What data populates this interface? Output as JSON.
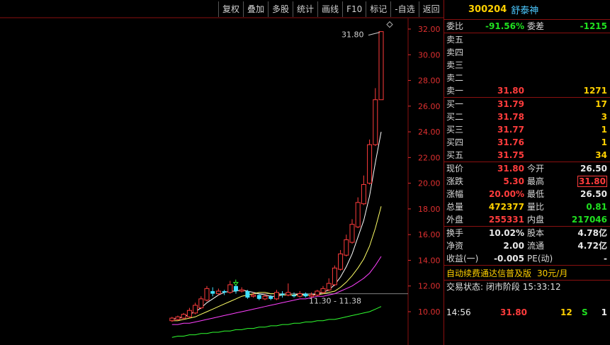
{
  "toolbar": {
    "buttons": [
      "复权",
      "叠加",
      "多股",
      "统计",
      "画线",
      "F10",
      "标记",
      "-自选",
      "返回"
    ]
  },
  "chart_data": {
    "type": "candlestick",
    "y_ticks": [
      "32.00",
      "30.00",
      "28.00",
      "26.00",
      "24.00",
      "22.00",
      "20.00",
      "18.00",
      "16.00",
      "14.00",
      "12.00",
      "10.00"
    ],
    "ylim": [
      9.6,
      32.4
    ],
    "annotations": {
      "max_label": "31.80",
      "range_label": "11.30 - 11.38"
    },
    "candles": [
      {
        "o": 9.3,
        "c": 9.5,
        "h": 9.6,
        "l": 9.2
      },
      {
        "o": 9.4,
        "c": 9.6,
        "h": 9.7,
        "l": 9.3
      },
      {
        "o": 9.5,
        "c": 9.8,
        "h": 9.9,
        "l": 9.4
      },
      {
        "o": 9.6,
        "c": 10.1,
        "h": 10.3,
        "l": 9.5
      },
      {
        "o": 9.9,
        "c": 10.5,
        "h": 10.7,
        "l": 9.8
      },
      {
        "o": 10.3,
        "c": 11.0,
        "h": 11.2,
        "l": 10.2
      },
      {
        "o": 10.9,
        "c": 11.8,
        "h": 12.0,
        "l": 10.8
      },
      {
        "o": 11.6,
        "c": 11.4,
        "h": 11.9,
        "l": 11.2
      },
      {
        "o": 11.4,
        "c": 11.6,
        "h": 11.8,
        "l": 11.3
      },
      {
        "o": 11.6,
        "c": 11.5,
        "h": 11.7,
        "l": 11.3
      },
      {
        "o": 11.5,
        "c": 12.1,
        "h": 12.4,
        "l": 11.4
      },
      {
        "o": 12.0,
        "c": 11.6,
        "h": 12.1,
        "l": 11.4
      },
      {
        "o": 11.6,
        "c": 11.7,
        "h": 11.9,
        "l": 11.5
      },
      {
        "o": 11.6,
        "c": 11.1,
        "h": 11.7,
        "l": 11.0
      },
      {
        "o": 11.2,
        "c": 11.3,
        "h": 11.5,
        "l": 11.1
      },
      {
        "o": 11.3,
        "c": 11.0,
        "h": 11.4,
        "l": 10.9
      },
      {
        "o": 11.0,
        "c": 11.2,
        "h": 11.4,
        "l": 10.9
      },
      {
        "o": 11.2,
        "c": 11.0,
        "h": 11.3,
        "l": 10.9
      },
      {
        "o": 11.0,
        "c": 11.5,
        "h": 11.7,
        "l": 10.9
      },
      {
        "o": 11.4,
        "c": 11.3,
        "h": 11.6,
        "l": 11.1
      },
      {
        "o": 11.3,
        "c": 11.5,
        "h": 12.2,
        "l": 11.2
      },
      {
        "o": 11.3,
        "c": 11.2,
        "h": 11.5,
        "l": 11.1
      },
      {
        "o": 11.2,
        "c": 11.4,
        "h": 11.6,
        "l": 11.1
      },
      {
        "o": 11.4,
        "c": 11.2,
        "h": 11.5,
        "l": 11.1
      },
      {
        "o": 11.2,
        "c": 11.3,
        "h": 11.5,
        "l": 11.1
      },
      {
        "o": 11.3,
        "c": 11.6,
        "h": 11.7,
        "l": 11.2
      },
      {
        "o": 11.5,
        "c": 11.8,
        "h": 12.0,
        "l": 11.4
      },
      {
        "o": 11.7,
        "c": 12.2,
        "h": 12.6,
        "l": 11.6
      },
      {
        "o": 12.1,
        "c": 13.4,
        "h": 13.6,
        "l": 12.0
      },
      {
        "o": 13.3,
        "c": 14.5,
        "h": 14.8,
        "l": 13.2
      },
      {
        "o": 14.4,
        "c": 15.6,
        "h": 16.0,
        "l": 14.3
      },
      {
        "o": 15.4,
        "c": 16.8,
        "h": 17.2,
        "l": 15.3
      },
      {
        "o": 16.6,
        "c": 18.5,
        "h": 18.9,
        "l": 16.5
      },
      {
        "o": 18.4,
        "c": 19.9,
        "h": 20.6,
        "l": 18.3
      },
      {
        "o": 20.0,
        "c": 23.0,
        "h": 23.4,
        "l": 19.9
      },
      {
        "o": 23.0,
        "c": 26.5,
        "h": 27.4,
        "l": 22.9
      },
      {
        "o": 26.5,
        "c": 31.8,
        "h": 31.8,
        "l": 26.5
      }
    ],
    "ma_lines": [
      {
        "name": "MA5",
        "color": "#ffffff",
        "values": [
          9.4,
          9.5,
          9.6,
          9.8,
          10.0,
          10.3,
          10.7,
          11.0,
          11.3,
          11.5,
          11.6,
          11.6,
          11.7,
          11.6,
          11.5,
          11.4,
          11.3,
          11.2,
          11.2,
          11.3,
          11.3,
          11.3,
          11.4,
          11.3,
          11.3,
          11.4,
          11.5,
          11.7,
          12.1,
          12.7,
          13.5,
          14.5,
          15.8,
          17.1,
          19.0,
          21.6,
          24.0
        ]
      },
      {
        "name": "MA10",
        "color": "#ffff66",
        "values": [
          9.3,
          9.3,
          9.4,
          9.5,
          9.6,
          9.8,
          10.0,
          10.2,
          10.4,
          10.6,
          10.8,
          11.0,
          11.2,
          11.3,
          11.4,
          11.5,
          11.5,
          11.4,
          11.4,
          11.3,
          11.3,
          11.3,
          11.3,
          11.3,
          11.3,
          11.3,
          11.4,
          11.5,
          11.6,
          11.9,
          12.3,
          12.8,
          13.4,
          14.1,
          15.1,
          16.5,
          18.2
        ]
      },
      {
        "name": "MA20",
        "color": "#ff40ff",
        "values": [
          9.0,
          9.0,
          9.1,
          9.1,
          9.2,
          9.3,
          9.4,
          9.5,
          9.6,
          9.7,
          9.8,
          9.9,
          10.0,
          10.1,
          10.2,
          10.3,
          10.4,
          10.5,
          10.6,
          10.7,
          10.8,
          10.9,
          11.0,
          11.0,
          11.1,
          11.2,
          11.2,
          11.3,
          11.4,
          11.6,
          11.8,
          12.0,
          12.3,
          12.6,
          13.0,
          13.6,
          14.3
        ]
      },
      {
        "name": "MA60",
        "color": "#30ff30",
        "values": [
          8.0,
          8.1,
          8.1,
          8.2,
          8.2,
          8.3,
          8.3,
          8.4,
          8.4,
          8.5,
          8.5,
          8.6,
          8.6,
          8.7,
          8.7,
          8.8,
          8.8,
          8.9,
          8.9,
          9.0,
          9.0,
          9.1,
          9.1,
          9.2,
          9.2,
          9.3,
          9.3,
          9.4,
          9.4,
          9.5,
          9.6,
          9.7,
          9.8,
          9.9,
          10.0,
          10.2,
          10.4
        ]
      }
    ],
    "colors": {
      "up": "#ff3c3c",
      "down": "#40e0ff",
      "ref_line": "#808080",
      "tick": "#e03030"
    }
  },
  "quote": {
    "code": "300204",
    "name": "舒泰神",
    "weibi_label": "委比",
    "weibi_value": "-91.56%",
    "weicha_label": "委差",
    "weicha_value": "-1215",
    "asks": [
      {
        "label": "卖五",
        "price": "",
        "vol": ""
      },
      {
        "label": "卖四",
        "price": "",
        "vol": ""
      },
      {
        "label": "卖三",
        "price": "",
        "vol": ""
      },
      {
        "label": "卖二",
        "price": "",
        "vol": ""
      },
      {
        "label": "卖一",
        "price": "31.80",
        "vol": "1271"
      }
    ],
    "bids": [
      {
        "label": "买一",
        "price": "31.79",
        "vol": "17"
      },
      {
        "label": "买二",
        "price": "31.78",
        "vol": "3"
      },
      {
        "label": "买三",
        "price": "31.77",
        "vol": "1"
      },
      {
        "label": "买四",
        "price": "31.76",
        "vol": "1"
      },
      {
        "label": "买五",
        "price": "31.75",
        "vol": "34"
      }
    ],
    "stats": [
      {
        "l1": "现价",
        "v1": "31.80",
        "c1": "red",
        "l2": "今开",
        "v2": "26.50",
        "c2": "white"
      },
      {
        "l1": "涨跌",
        "v1": "5.30",
        "c1": "red",
        "l2": "最高",
        "v2": "31.80",
        "c2": "red"
      },
      {
        "l1": "涨幅",
        "v1": "20.00%",
        "c1": "red",
        "l2": "最低",
        "v2": "26.50",
        "c2": "white"
      },
      {
        "l1": "总量",
        "v1": "472377",
        "c1": "yellow",
        "l2": "量比",
        "v2": "0.81",
        "c2": "green"
      },
      {
        "l1": "外盘",
        "v1": "255331",
        "c1": "red",
        "l2": "内盘",
        "v2": "217046",
        "c2": "green"
      }
    ],
    "fundamentals": [
      {
        "l1": "换手",
        "v1": "10.02%",
        "l2": "股本",
        "v2": "4.78亿"
      },
      {
        "l1": "净资",
        "v1": "2.00",
        "l2": "流通",
        "v2": "4.72亿"
      },
      {
        "l1": "收益(一)",
        "v1": "-0.005",
        "l2": "PE(动)",
        "v2": "-"
      }
    ],
    "promo_text": "自动续费通达信普及版",
    "promo_price": "30元/月",
    "trade_status_label": "交易状态:",
    "trade_status_value": "闭市阶段",
    "trade_status_time": "15:33:12",
    "ticks": [
      {
        "time": "",
        "price": "",
        "vol": "",
        "dir": "",
        "n": ""
      },
      {
        "time": "14:56",
        "price": "31.80",
        "vol": "12",
        "dir": "S",
        "n": "1"
      }
    ]
  }
}
